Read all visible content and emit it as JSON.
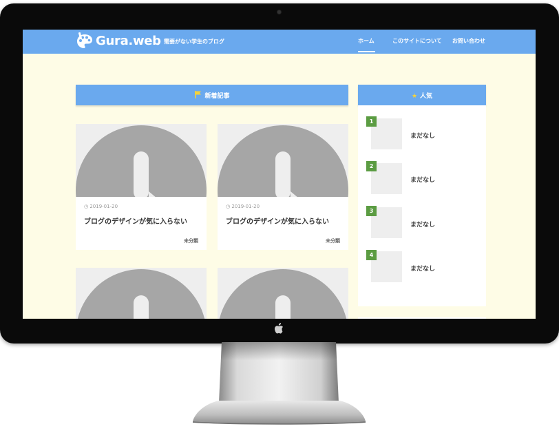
{
  "header": {
    "site_title": "Gura.web",
    "tagline": "需要がない学生のブログ",
    "nav": [
      {
        "label": "ホーム",
        "active": true
      },
      {
        "label": "このサイトについて",
        "active": false
      },
      {
        "label": "お問い合わせ",
        "active": false
      }
    ]
  },
  "main": {
    "section_title": "新着記事",
    "section_icon": "flag-icon",
    "posts": [
      {
        "date": "2019-01-20",
        "title": "ブログのデザインが気に入らない",
        "category": "未分類"
      },
      {
        "date": "2019-01-20",
        "title": "ブログのデザインが気に入らない",
        "category": "未分類"
      },
      {
        "date": "",
        "title": "",
        "category": ""
      },
      {
        "date": "",
        "title": "",
        "category": ""
      }
    ]
  },
  "sidebar": {
    "title": "人気",
    "title_icon": "star-icon",
    "ranking": [
      {
        "rank": "1",
        "label": "まだなし"
      },
      {
        "rank": "2",
        "label": "まだなし"
      },
      {
        "rank": "3",
        "label": "まだなし"
      },
      {
        "rank": "4",
        "label": "まだなし"
      }
    ]
  },
  "colors": {
    "accent": "#6aa9ee",
    "page_bg": "#fefce6",
    "rank_badge": "#5b9c42",
    "placeholder_gray": "#a6a6a6"
  }
}
